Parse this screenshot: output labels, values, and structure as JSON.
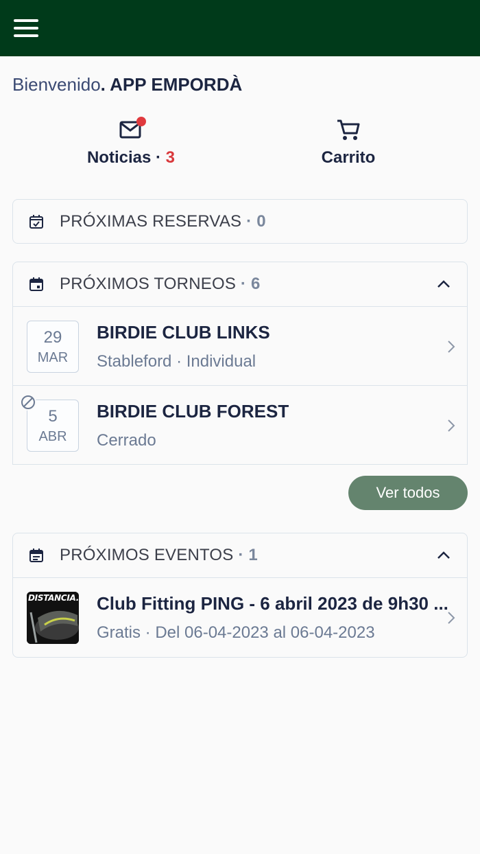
{
  "header": {
    "menu_icon": "hamburger-menu-icon",
    "bg_color": "#003a1a"
  },
  "welcome": {
    "greeting": "Bienvenido",
    "club": ". APP EMPORDÀ"
  },
  "quick_actions": {
    "news": {
      "icon": "mail-icon",
      "label": "Noticias",
      "separator": " · ",
      "count": "3",
      "has_unread_dot": true
    },
    "cart": {
      "icon": "cart-icon",
      "label": "Carrito"
    }
  },
  "reservations": {
    "icon": "calendar-check-icon",
    "title": "PRÓXIMAS RESERVAS",
    "separator": " · ",
    "count": "0"
  },
  "tournaments": {
    "icon": "calendar-icon",
    "title": "PRÓXIMOS TORNEOS",
    "separator": " · ",
    "count": "6",
    "collapse_icon": "chevron-up-icon",
    "items": [
      {
        "day": "29",
        "month": "MAR",
        "name": "BIRDIE CLUB LINKS",
        "detail": "Stableford · Individual",
        "blocked": false
      },
      {
        "day": "5",
        "month": "ABR",
        "name": "BIRDIE CLUB FOREST",
        "detail": "Cerrado",
        "blocked": true,
        "blocked_icon": "blocked-icon"
      }
    ],
    "see_all_label": "Ver todos"
  },
  "events": {
    "icon": "calendar-list-icon",
    "title": "PRÓXIMOS EVENTOS",
    "separator": " · ",
    "count": "1",
    "collapse_icon": "chevron-up-icon",
    "items": [
      {
        "thumb_text": "DISTANCIA.",
        "name": "Club Fitting PING - 6 abril 2023 de 9h30 ...",
        "detail": "Gratis · Del 06-04-2023 al 06-04-2023"
      }
    ]
  },
  "colors": {
    "primary_text": "#1c2541",
    "count_red": "#d9393c",
    "button_green": "#64846e"
  }
}
